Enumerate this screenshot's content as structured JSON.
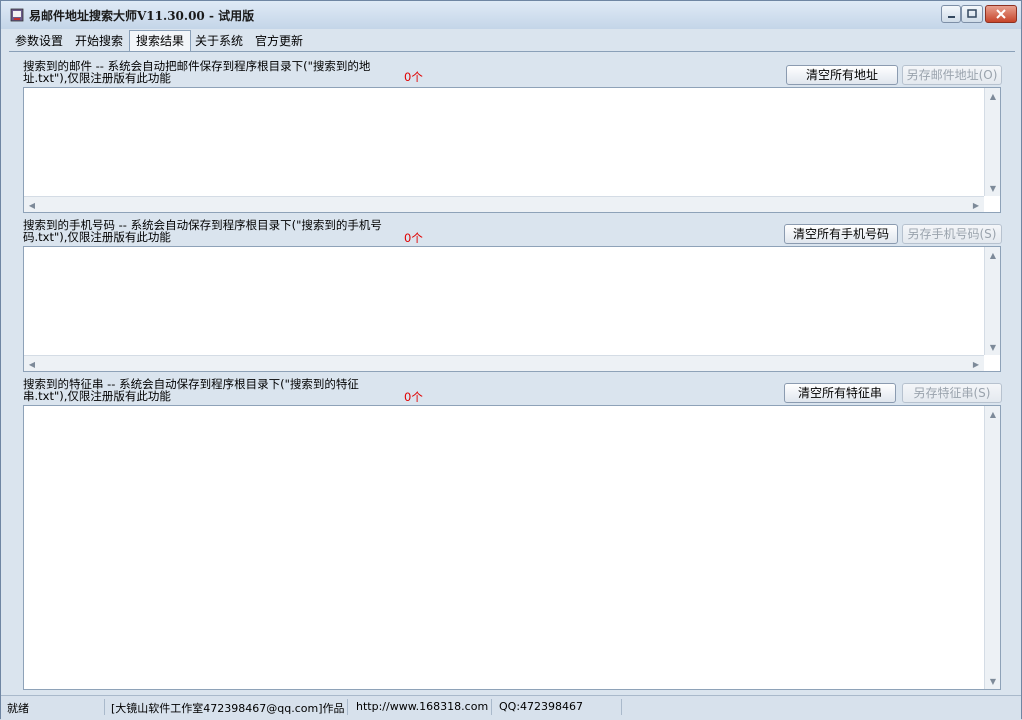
{
  "window": {
    "title": "易邮件地址搜索大师V11.30.00 - 试用版"
  },
  "tabs": [
    "参数设置",
    "开始搜索",
    "搜索结果",
    "关于系统",
    "官方更新"
  ],
  "sections": [
    {
      "label": "搜索到的邮件 -- 系统会自动把邮件保存到程序根目录下(\"搜索到的地址.txt\"),仅限注册版有此功能",
      "count": "0个",
      "clear_button": "清空所有地址",
      "save_button": "另存邮件地址(O)"
    },
    {
      "label": "搜索到的手机号码 -- 系统会自动保存到程序根目录下(\"搜索到的手机号码.txt\"),仅限注册版有此功能",
      "count": "0个",
      "clear_button": "清空所有手机号码",
      "save_button": "另存手机号码(S)"
    },
    {
      "label": "搜索到的特征串 -- 系统会自动保存到程序根目录下(\"搜索到的特征串.txt\"),仅限注册版有此功能",
      "count": "0个",
      "clear_button": "清空所有特征串",
      "save_button": "另存特征串(S)"
    }
  ],
  "statusbar": {
    "status": "就绪",
    "author": "[大镜山软件工作室472398467@qq.com]作品",
    "website": "http://www.168318.com",
    "qq": "QQ:472398467"
  }
}
